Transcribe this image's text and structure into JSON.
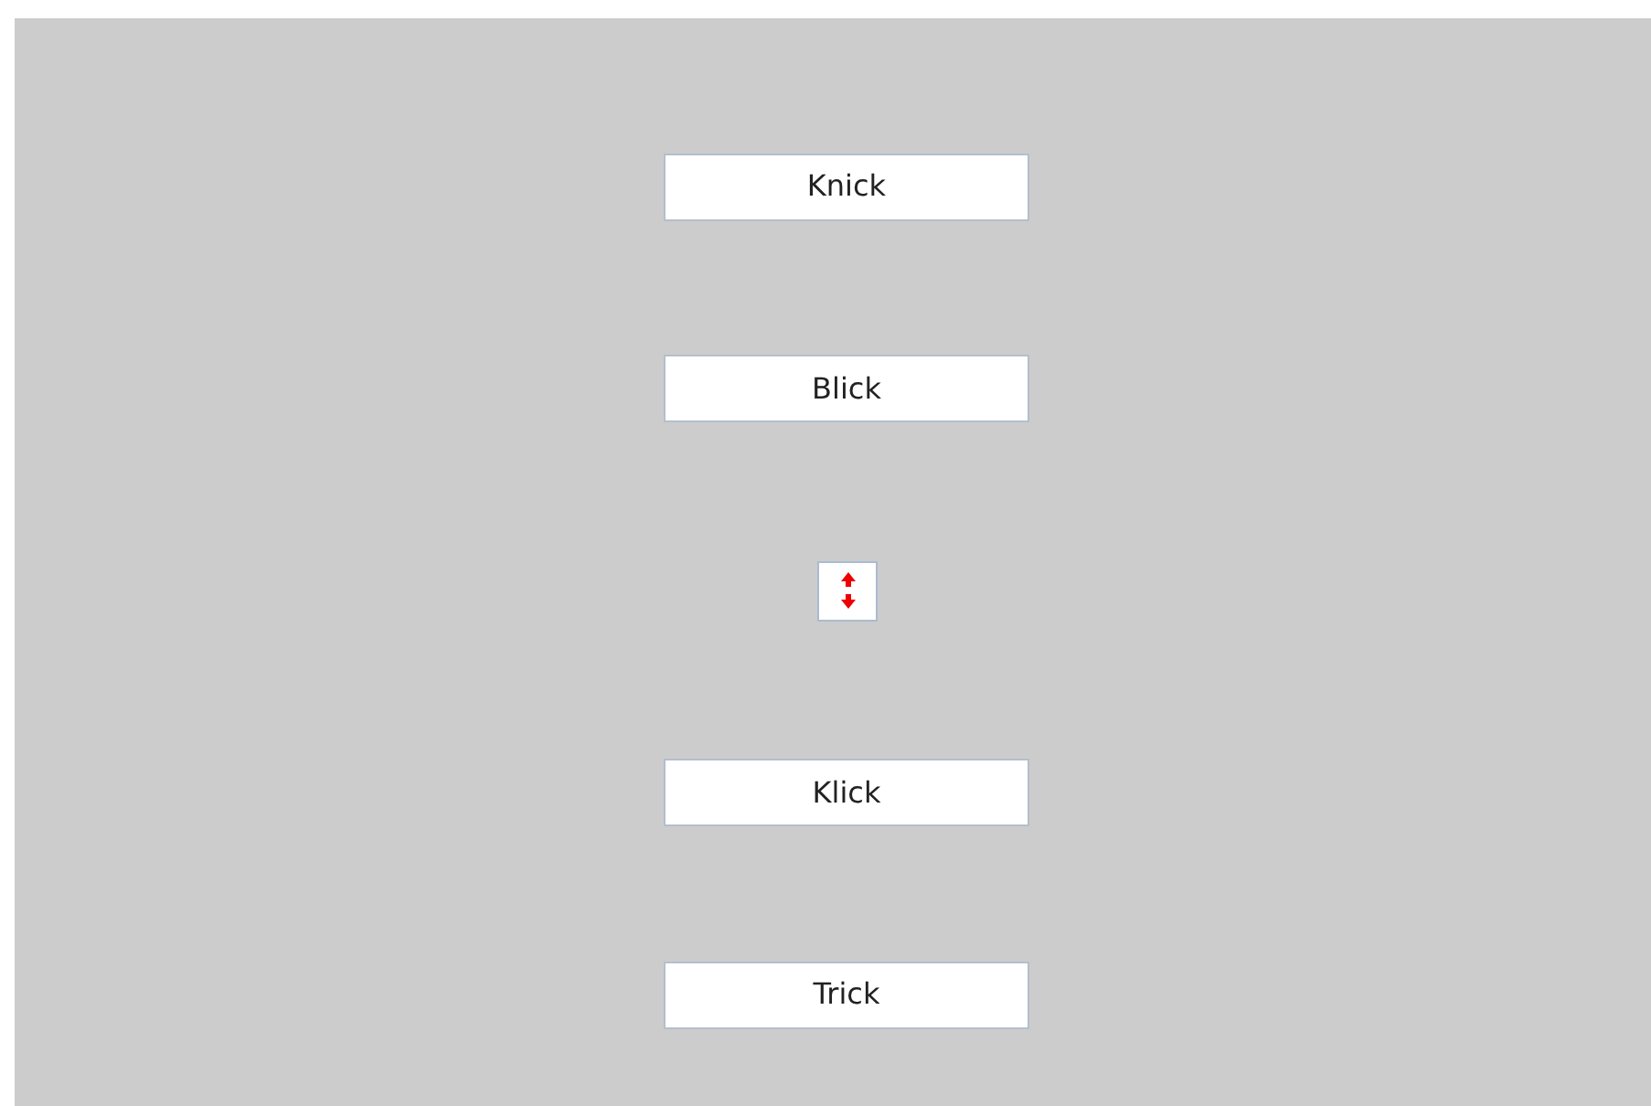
{
  "items": [
    {
      "kind": "button",
      "label": "Knick"
    },
    {
      "kind": "button",
      "label": "Blick"
    },
    {
      "kind": "swap"
    },
    {
      "kind": "button",
      "label": "Klick"
    },
    {
      "kind": "button",
      "label": "Trick"
    }
  ]
}
